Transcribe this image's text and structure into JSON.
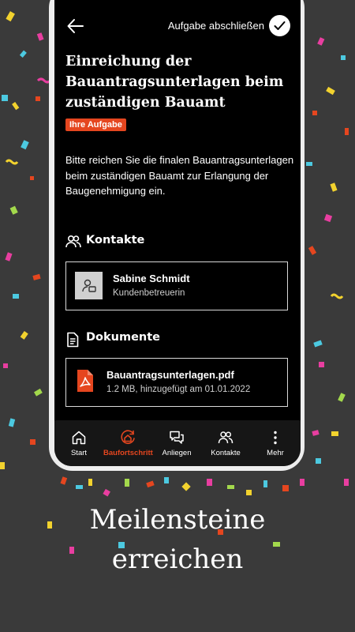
{
  "header": {
    "complete_label": "Aufgabe abschließen"
  },
  "task": {
    "title": "Einreichung der Bauantragsunterlagen beim zuständigen Bauamt",
    "badge": "Ihre Aufgabe",
    "description": "Bitte reichen Sie die finalen Bauantragsunterlagen beim zuständigen Bauamt zur Erlangung der Baugenehmigung ein."
  },
  "contacts": {
    "heading": "Kontakte",
    "items": [
      {
        "name": "Sabine Schmidt",
        "role": "Kundenbetreuerin"
      }
    ]
  },
  "documents": {
    "heading": "Dokumente",
    "items": [
      {
        "filename": "Bauantragsunterlagen.pdf",
        "meta": "1.2 MB, hinzugefügt am 01.01.2022"
      }
    ]
  },
  "nav": {
    "active": "Baufortschritt",
    "items": [
      {
        "label": "Start",
        "icon": "home-icon"
      },
      {
        "label": "Baufortschritt",
        "icon": "build-progress-icon"
      },
      {
        "label": "Anliegen",
        "icon": "chat-icon"
      },
      {
        "label": "Kontakte",
        "icon": "people-icon"
      },
      {
        "label": "Mehr",
        "icon": "more-vertical-icon"
      }
    ]
  },
  "tagline": {
    "line1": "Meilensteine",
    "line2": "erreichen"
  },
  "colors": {
    "background": "#3a3a3a",
    "accent": "#e5461f",
    "screen": "#000000",
    "nav_bg": "#161616"
  }
}
